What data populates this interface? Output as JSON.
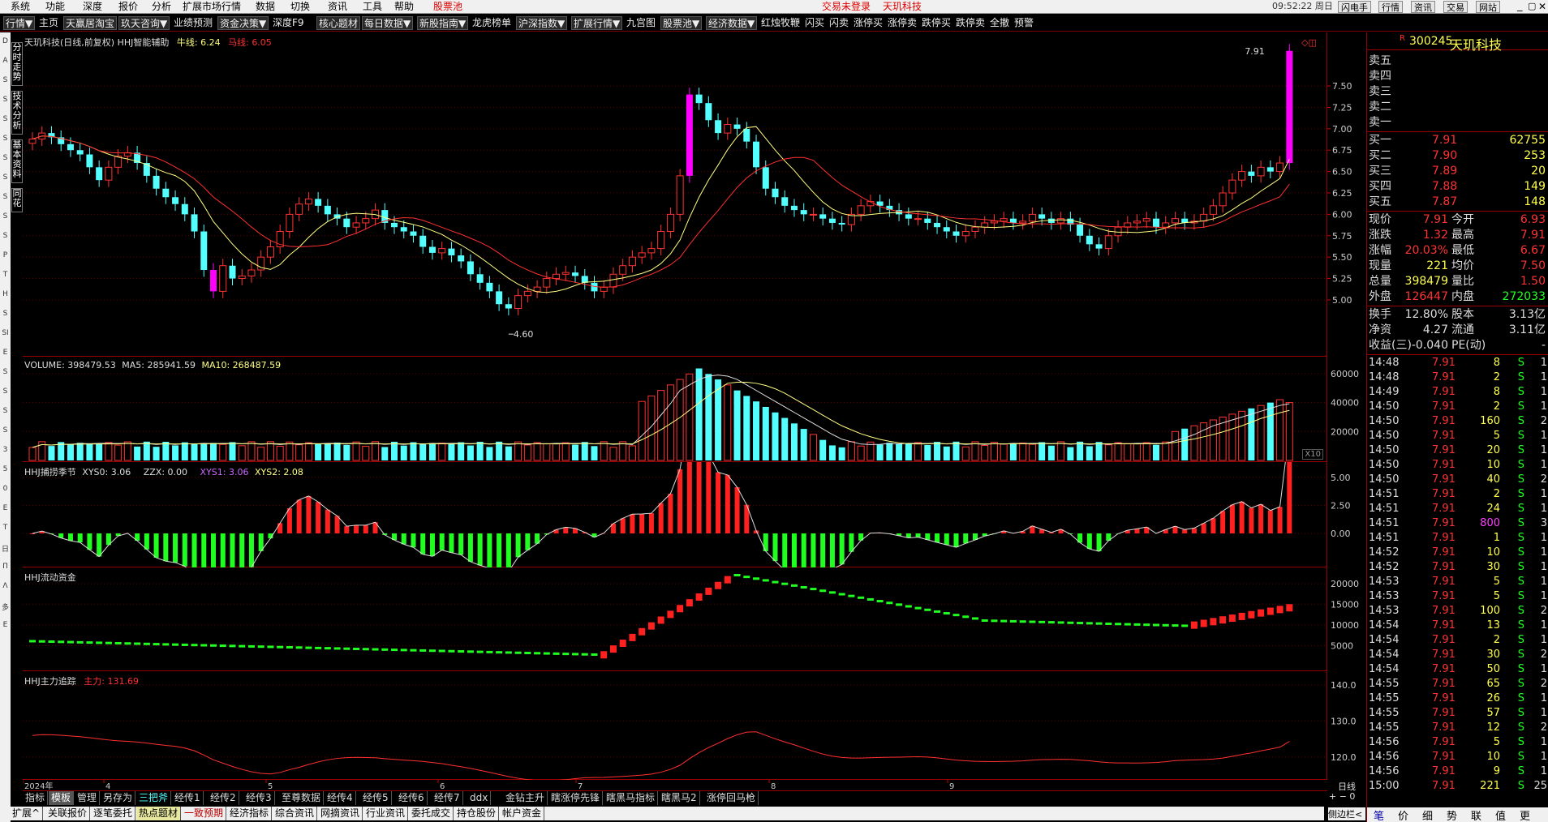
{
  "menubar": {
    "items": [
      "系统",
      "功能",
      "深度",
      "报价",
      "分析",
      "扩展市场行情",
      "数据",
      "切换",
      "资讯",
      "工具",
      "帮助"
    ],
    "stock_pool": "股票池",
    "login_status": "交易未登录",
    "stock_name_top": "天玑科技",
    "clock": "09:52:22 周日",
    "right_buttons": [
      "闪电手",
      "行情",
      "资讯",
      "交易",
      "网站"
    ]
  },
  "toolbar": {
    "items": [
      "行情▼",
      "主页",
      "天赢居淘宝",
      "玖天咨询▼",
      "业绩预测",
      "资金决策▼",
      "深度F9",
      "核心题材",
      "每日数据▼",
      "新股指南▼",
      "龙虎榜单",
      "沪深指数▼",
      "扩展行情▼",
      "九宫图",
      "股票池▼",
      "经济数据▼",
      "红烛牧鞭",
      "闪买",
      "闪卖",
      "涨停买",
      "涨停卖",
      "跌停买",
      "跌停卖",
      "全撤",
      "预警"
    ]
  },
  "side_tabs": [
    "分时走势",
    "技术分析",
    "基本资料",
    "同花"
  ],
  "side_letters": [
    "D",
    "A",
    "S",
    "S",
    "S",
    "S",
    "S",
    "S",
    "S",
    "S",
    "S",
    "P",
    "T",
    "H",
    "S",
    "SI",
    "E",
    "S",
    "S",
    "S",
    "S",
    "3",
    "5",
    "0",
    "E",
    "T",
    "日",
    "Π",
    "Λ",
    "多",
    "E"
  ],
  "main_chart": {
    "title": "天玑科技(日线,前复权) HHJ智能辅助",
    "ma_bull_label": "牛线:",
    "ma_bull_value": "6.24",
    "ma_horse_label": "马线:",
    "ma_horse_value": "6.05",
    "high_marker": "7.91",
    "low_marker": "4.60",
    "y_ticks": [
      "7.50",
      "7.25",
      "7.00",
      "6.75",
      "6.50",
      "6.25",
      "6.00",
      "5.75",
      "5.50",
      "5.25",
      "5.00"
    ]
  },
  "volume_panel": {
    "label": "VOLUME: 398479.53",
    "ma5": "MA5: 285941.59",
    "ma10": "MA10: 268487.59",
    "y_ticks": [
      "60000",
      "40000",
      "20000"
    ],
    "unit": "X10"
  },
  "season_panel": {
    "label": "HHJ捕捞季节",
    "xys0": "XYS0: 3.06",
    "zzx": "ZZX: 0.00",
    "xys1": "XYS1: 3.06",
    "xys2": "XYS2: 2.08",
    "y_ticks": [
      "5.00",
      "2.50",
      "0.00"
    ]
  },
  "flow_panel": {
    "label": "HHJ流动资金",
    "y_ticks": [
      "20000",
      "15000",
      "10000",
      "5000"
    ]
  },
  "track_panel": {
    "label": "HHJ主力追踪",
    "main_force": "主力: 131.69",
    "y_ticks": [
      "140.0",
      "130.0",
      "120.0"
    ]
  },
  "x_labels": [
    "2024年",
    "4",
    "5",
    "6",
    "7",
    "8",
    "9"
  ],
  "period": "日线",
  "indicator_tabs": [
    "指标",
    "模板",
    "管理",
    "另存为",
    "三把斧",
    "经传1",
    "经传2",
    "经传3",
    "至尊数据",
    "经传4",
    "经传5",
    "经传6",
    "经传7",
    "ddx",
    "金钻主升",
    "瞎涨停先锋",
    "瞎黑马指标",
    "瞎黑马2",
    "涨停回马枪"
  ],
  "func_tabs": [
    "扩展^",
    "关联报价",
    "逐笔委托",
    "热点题材",
    "一致预期",
    "经济指标",
    "综合资讯",
    "网摘资讯",
    "行业资讯",
    "委托成交",
    "持仓股份",
    "帐户资金"
  ],
  "right_panel": {
    "code": "300245",
    "name": "天玑科技",
    "sell_levels": [
      "卖五",
      "卖四",
      "卖三",
      "卖二",
      "卖一"
    ],
    "buy_levels": [
      {
        "label": "买一",
        "price": "7.91",
        "vol": "62755"
      },
      {
        "label": "买二",
        "price": "7.90",
        "vol": "253"
      },
      {
        "label": "买三",
        "price": "7.89",
        "vol": "20"
      },
      {
        "label": "买四",
        "price": "7.88",
        "vol": "149"
      },
      {
        "label": "买五",
        "price": "7.87",
        "vol": "148"
      }
    ],
    "quote": [
      {
        "l1": "现价",
        "v1": "7.91",
        "l2": "今开",
        "v2": "6.93"
      },
      {
        "l1": "涨跌",
        "v1": "1.32",
        "l2": "最高",
        "v2": "7.91"
      },
      {
        "l1": "涨幅",
        "v1": "20.03%",
        "l2": "最低",
        "v2": "6.67"
      },
      {
        "l1": "现量",
        "v1": "221",
        "l2": "均价",
        "v2": "7.50"
      },
      {
        "l1": "总量",
        "v1": "398479",
        "l2": "量比",
        "v2": "1.50"
      },
      {
        "l1": "外盘",
        "v1": "126447",
        "l2": "内盘",
        "v2": "272033"
      }
    ],
    "stats": [
      {
        "l1": "换手",
        "v1": "12.80%",
        "l2": "股本",
        "v2": "3.13亿"
      },
      {
        "l1": "净资",
        "v1": "4.27",
        "l2": "流通",
        "v2": "3.11亿"
      },
      {
        "l1": "收益(三)",
        "v1": "-0.040",
        "l2": "PE(动)",
        "v2": "-"
      }
    ],
    "ticks": [
      {
        "t": "14:48",
        "p": "7.91",
        "v": "8",
        "d": "S",
        "n": "1"
      },
      {
        "t": "14:48",
        "p": "7.91",
        "v": "2",
        "d": "S",
        "n": "1"
      },
      {
        "t": "14:49",
        "p": "7.91",
        "v": "8",
        "d": "S",
        "n": "1"
      },
      {
        "t": "14:50",
        "p": "7.91",
        "v": "2",
        "d": "S",
        "n": "1"
      },
      {
        "t": "14:50",
        "p": "7.91",
        "v": "160",
        "d": "S",
        "n": "2"
      },
      {
        "t": "14:50",
        "p": "7.91",
        "v": "5",
        "d": "S",
        "n": "1"
      },
      {
        "t": "14:50",
        "p": "7.91",
        "v": "20",
        "d": "S",
        "n": "1"
      },
      {
        "t": "14:50",
        "p": "7.91",
        "v": "10",
        "d": "S",
        "n": "1"
      },
      {
        "t": "14:50",
        "p": "7.91",
        "v": "40",
        "d": "S",
        "n": "2"
      },
      {
        "t": "14:51",
        "p": "7.91",
        "v": "2",
        "d": "S",
        "n": "1"
      },
      {
        "t": "14:51",
        "p": "7.91",
        "v": "24",
        "d": "S",
        "n": "1"
      },
      {
        "t": "14:51",
        "p": "7.91",
        "v": "800",
        "d": "S",
        "n": "3"
      },
      {
        "t": "14:51",
        "p": "7.91",
        "v": "1",
        "d": "S",
        "n": "1"
      },
      {
        "t": "14:52",
        "p": "7.91",
        "v": "10",
        "d": "S",
        "n": "1"
      },
      {
        "t": "14:52",
        "p": "7.91",
        "v": "30",
        "d": "S",
        "n": "1"
      },
      {
        "t": "14:53",
        "p": "7.91",
        "v": "5",
        "d": "S",
        "n": "1"
      },
      {
        "t": "14:53",
        "p": "7.91",
        "v": "5",
        "d": "S",
        "n": "1"
      },
      {
        "t": "14:53",
        "p": "7.91",
        "v": "100",
        "d": "S",
        "n": "2"
      },
      {
        "t": "14:54",
        "p": "7.91",
        "v": "13",
        "d": "S",
        "n": "1"
      },
      {
        "t": "14:54",
        "p": "7.91",
        "v": "2",
        "d": "S",
        "n": "1"
      },
      {
        "t": "14:54",
        "p": "7.91",
        "v": "30",
        "d": "S",
        "n": "2"
      },
      {
        "t": "14:54",
        "p": "7.91",
        "v": "50",
        "d": "S",
        "n": "1"
      },
      {
        "t": "14:55",
        "p": "7.91",
        "v": "65",
        "d": "S",
        "n": "2"
      },
      {
        "t": "14:55",
        "p": "7.91",
        "v": "26",
        "d": "S",
        "n": "1"
      },
      {
        "t": "14:55",
        "p": "7.91",
        "v": "57",
        "d": "S",
        "n": "1"
      },
      {
        "t": "14:55",
        "p": "7.91",
        "v": "12",
        "d": "S",
        "n": "2"
      },
      {
        "t": "14:56",
        "p": "7.91",
        "v": "5",
        "d": "S",
        "n": "1"
      },
      {
        "t": "14:56",
        "p": "7.91",
        "v": "10",
        "d": "S",
        "n": "1"
      },
      {
        "t": "14:56",
        "p": "7.91",
        "v": "9",
        "d": "S",
        "n": "1"
      },
      {
        "t": "15:00",
        "p": "7.91",
        "v": "221",
        "d": "S",
        "n": "25"
      }
    ],
    "bottom_tabs": [
      "笔",
      "价",
      "细",
      "势",
      "联",
      "值",
      "更"
    ],
    "sidebar_label": "侧边栏<"
  },
  "colors": {
    "up": "#ff3333",
    "down": "#54ffff",
    "limit": "#ff00ff",
    "ma_bull": "#ffff80",
    "ma_horse": "#ff3030",
    "grid": "#600000",
    "axis": "#c00000"
  },
  "chart_data": [
    {
      "type": "candlestick",
      "title": "天玑科技(日线,前复权)",
      "ylim": [
        4.6,
        7.91
      ],
      "x_labels": [
        "2024年",
        "4",
        "5",
        "6",
        "7",
        "8",
        "9"
      ],
      "high_marker": 7.91,
      "low_marker": 4.6,
      "close": [
        6.88,
        6.95,
        6.9,
        6.82,
        6.75,
        6.7,
        6.55,
        6.4,
        6.55,
        6.68,
        6.72,
        6.6,
        6.45,
        6.3,
        6.2,
        6.12,
        6.0,
        5.8,
        5.35,
        5.1,
        5.4,
        5.25,
        5.28,
        5.35,
        5.5,
        5.62,
        5.8,
        6.0,
        6.12,
        6.18,
        6.1,
        6.0,
        5.95,
        5.85,
        5.9,
        5.95,
        6.05,
        5.9,
        5.85,
        5.8,
        5.75,
        5.62,
        5.55,
        5.6,
        5.52,
        5.45,
        5.3,
        5.2,
        5.1,
        4.95,
        4.9,
        5.05,
        5.1,
        5.15,
        5.25,
        5.3,
        5.32,
        5.28,
        5.2,
        5.1,
        5.15,
        5.3,
        5.4,
        5.5,
        5.55,
        5.6,
        5.8,
        6.0,
        6.45,
        7.4,
        7.3,
        7.1,
        6.95,
        7.05,
        7.0,
        6.85,
        6.55,
        6.3,
        6.2,
        6.1,
        6.05,
        6.0,
        6.0,
        5.95,
        5.9,
        5.88,
        6.0,
        6.1,
        6.15,
        6.1,
        6.05,
        6.0,
        5.95,
        5.95,
        5.9,
        5.85,
        5.8,
        5.75,
        5.8,
        5.85,
        5.9,
        5.92,
        5.95,
        5.9,
        5.92,
        6.0,
        5.95,
        5.9,
        5.95,
        5.88,
        5.75,
        5.65,
        5.6,
        5.75,
        5.85,
        5.9,
        5.92,
        5.95,
        5.85,
        5.9,
        5.95,
        5.9,
        5.92,
        6.0,
        6.1,
        6.25,
        6.4,
        6.5,
        6.45,
        6.55,
        6.5,
        6.6,
        7.91
      ],
      "ma_bull": 6.24,
      "ma_horse": 6.05
    },
    {
      "type": "bar",
      "title": "VOLUME",
      "values_label": "VOLUME: 398479.53",
      "ma5": 285941.59,
      "ma10": 268487.59,
      "ylim": [
        0,
        65000
      ],
      "y_ticks": [
        20000,
        40000,
        60000
      ]
    },
    {
      "type": "bar",
      "title": "HHJ捕捞季节",
      "ylim": [
        -2.5,
        5.0
      ],
      "y_ticks": [
        0,
        2.5,
        5.0
      ],
      "xys0": 3.06,
      "zzx": 0.0,
      "xys1": 3.06,
      "xys2": 2.08
    },
    {
      "type": "line",
      "title": "HHJ流动资金",
      "ylim": [
        0,
        22000
      ],
      "y_ticks": [
        5000,
        10000,
        15000,
        20000
      ]
    },
    {
      "type": "line",
      "title": "HHJ主力追踪",
      "ylim": [
        115,
        142
      ],
      "y_ticks": [
        120,
        130,
        140
      ],
      "main_force": 131.69
    }
  ]
}
